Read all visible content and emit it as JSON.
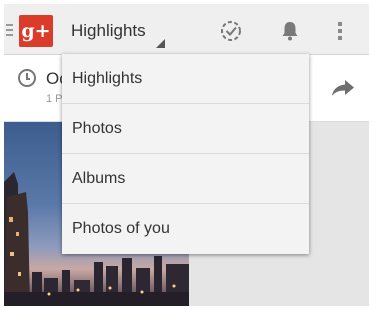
{
  "header": {
    "title": "Highlights",
    "logo_text": "g+",
    "brand_color": "#db3b29",
    "icons": [
      "menu-icon",
      "check-circle-icon",
      "bell-icon",
      "overflow-menu-icon"
    ]
  },
  "card": {
    "date_text": "Oc",
    "sub_text": "1 P",
    "icons": [
      "clock-icon",
      "share-icon"
    ]
  },
  "dropdown": {
    "items": [
      {
        "label": "Highlights"
      },
      {
        "label": "Photos"
      },
      {
        "label": "Albums"
      },
      {
        "label": "Photos of you"
      }
    ]
  }
}
